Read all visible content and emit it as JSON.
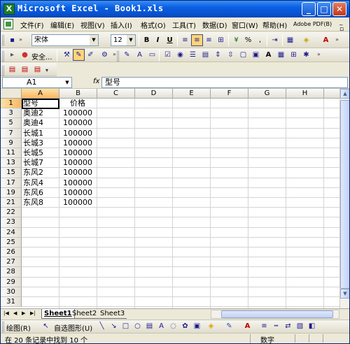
{
  "window": {
    "title": "Microsoft Excel - Book1.xls",
    "minimize": "_",
    "maximize": "□",
    "close": "✕"
  },
  "menubar": {
    "items": [
      "文件(F)",
      "编辑(E)",
      "视图(V)",
      "插入(I)",
      "格式(O)",
      "工具(T)",
      "数据(D)",
      "窗口(W)",
      "帮助(H)",
      "Adobe PDF(B)"
    ],
    "mdi_controls": "_ ▫ ✕"
  },
  "toolbar_format": {
    "font_name": "宋体",
    "font_size": "12",
    "bold": "B",
    "italic": "I",
    "underline": "U",
    "percent": "%",
    "comma": ","
  },
  "toolbar_security": {
    "security_label": "安全..."
  },
  "formula_bar": {
    "name_box": "A1",
    "fx": "fx",
    "content": "型号"
  },
  "sheet": {
    "columns": [
      "A",
      "B",
      "C",
      "D",
      "E",
      "F",
      "G",
      "H"
    ],
    "selected_column": "A",
    "rows": [
      {
        "num": "1",
        "a": "型号",
        "b": "价格"
      },
      {
        "num": "3",
        "a": "奥迪2",
        "b": "100000"
      },
      {
        "num": "5",
        "a": "奥迪4",
        "b": "100000"
      },
      {
        "num": "7",
        "a": "长城1",
        "b": "100000"
      },
      {
        "num": "9",
        "a": "长城3",
        "b": "100000"
      },
      {
        "num": "11",
        "a": "长城5",
        "b": "100000"
      },
      {
        "num": "13",
        "a": "长城7",
        "b": "100000"
      },
      {
        "num": "15",
        "a": "东风2",
        "b": "100000"
      },
      {
        "num": "17",
        "a": "东风4",
        "b": "100000"
      },
      {
        "num": "19",
        "a": "东风6",
        "b": "100000"
      },
      {
        "num": "21",
        "a": "东风8",
        "b": "100000"
      },
      {
        "num": "22",
        "a": "",
        "b": ""
      },
      {
        "num": "23",
        "a": "",
        "b": ""
      },
      {
        "num": "24",
        "a": "",
        "b": ""
      },
      {
        "num": "25",
        "a": "",
        "b": ""
      },
      {
        "num": "26",
        "a": "",
        "b": ""
      },
      {
        "num": "27",
        "a": "",
        "b": ""
      },
      {
        "num": "28",
        "a": "",
        "b": ""
      },
      {
        "num": "29",
        "a": "",
        "b": ""
      },
      {
        "num": "30",
        "a": "",
        "b": ""
      },
      {
        "num": "31",
        "a": "",
        "b": ""
      }
    ]
  },
  "tabs": {
    "sheets": [
      "Sheet1",
      "Sheet2",
      "Sheet3"
    ],
    "active": "Sheet1"
  },
  "drawbar": {
    "draw_label": "绘图(R)",
    "autoshapes_label": "自选图形(U)"
  },
  "status": {
    "message": "在 20 条记录中找到 10 个",
    "mode": "数字"
  }
}
